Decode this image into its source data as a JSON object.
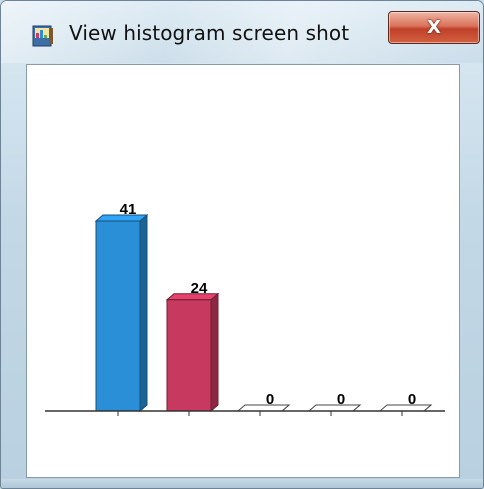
{
  "window": {
    "title": "View histogram screen shot",
    "app_icon": "histogram-app-icon",
    "close_icon": "close-icon",
    "close_glyph": "X"
  },
  "colors": {
    "bar_blue": "#2a8fd6",
    "bar_red": "#c8395f",
    "bar_empty": "#ffffff",
    "axis": "#333333",
    "close_button": "#c8452c"
  },
  "chart_data": {
    "type": "bar",
    "style": "3d",
    "categories": [
      "",
      "",
      "",
      "",
      ""
    ],
    "values": [
      41,
      24,
      0,
      0,
      0
    ],
    "value_labels": [
      "41",
      "24",
      "0",
      "0",
      "0"
    ],
    "bar_colors": [
      "#2a8fd6",
      "#c8395f",
      "#ffffff",
      "#ffffff",
      "#ffffff"
    ],
    "title": "",
    "xlabel": "",
    "ylabel": "",
    "ylim": [
      0,
      41
    ],
    "grid": false,
    "legend": "none"
  }
}
